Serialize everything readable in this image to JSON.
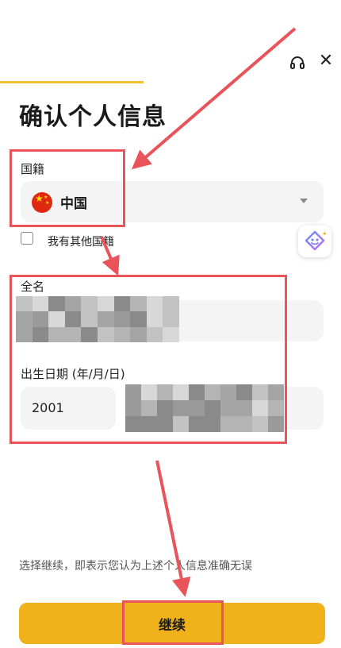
{
  "header": {
    "headset_icon": "headset-icon",
    "close_icon": "close-icon",
    "close_glyph": "✕",
    "progress": 0.42
  },
  "page": {
    "title": "确认个人信息"
  },
  "nationality": {
    "label": "国籍",
    "value": "中国",
    "flag_icon": "china-flag-icon"
  },
  "other_nationality": {
    "label": "我有其他国籍",
    "checked": false
  },
  "full_name": {
    "label": "全名"
  },
  "dob": {
    "label": "出生日期 (年/月/日)",
    "year": "2001"
  },
  "footer": {
    "disclaimer": "选择继续，即表示您认为上述个人信息准确无误",
    "continue_label": "继续"
  },
  "colors": {
    "accent": "#f0b21b",
    "progress": "#f2c12e",
    "annotation": "#e8545a"
  }
}
